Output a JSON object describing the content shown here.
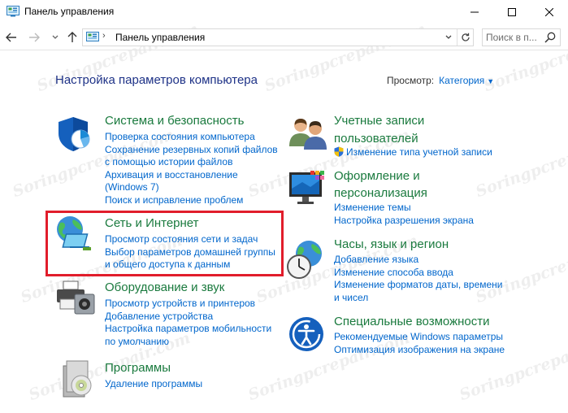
{
  "window": {
    "title": "Панель управления",
    "minimize_icon": "minimize-icon",
    "maximize_icon": "maximize-icon",
    "close_icon": "close-icon"
  },
  "nav": {
    "back_icon": "back-arrow-icon",
    "forward_icon": "forward-arrow-icon",
    "recent_icon": "chevron-down-icon",
    "up_icon": "up-arrow-icon"
  },
  "address": {
    "separator": "›",
    "path": "Панель управления"
  },
  "search": {
    "placeholder": "Поиск в п..."
  },
  "header": {
    "heading": "Настройка параметров компьютера",
    "view_label": "Просмотр:",
    "view_value": "Категория"
  },
  "categories_left": [
    {
      "title": "Система и безопасность",
      "icon": "shield-chart-icon",
      "links": [
        "Проверка состояния компьютера",
        "Сохранение резервных копий файлов",
        "с помощью истории файлов",
        "Архивация и восстановление",
        "(Windows 7)",
        "Поиск и исправление проблем"
      ]
    },
    {
      "title": "Сеть и Интернет",
      "icon": "network-globe-icon",
      "links": [
        "Просмотр состояния сети и задач",
        "Выбор параметров домашней группы",
        "и общего доступа к данным"
      ]
    },
    {
      "title": "Оборудование и звук",
      "icon": "printer-speaker-icon",
      "links": [
        "Просмотр устройств и принтеров",
        "Добавление устройства",
        "Настройка параметров мобильности",
        "по умолчанию"
      ]
    },
    {
      "title": "Программы",
      "icon": "programs-disc-icon",
      "links": [
        "Удаление программы"
      ]
    }
  ],
  "categories_right": [
    {
      "title_line1": "Учетные записи",
      "title_line2": "пользователей",
      "icon": "users-icon",
      "links": [
        "Изменение типа учетной записи"
      ]
    },
    {
      "title_line1": "Оформление и",
      "title_line2": "персонализация",
      "icon": "monitor-palette-icon",
      "links": [
        "Изменение темы",
        "Настройка разрешения экрана"
      ]
    },
    {
      "title": "Часы, язык и регион",
      "icon": "clock-globe-icon",
      "links": [
        "Добавление языка",
        "Изменение способа ввода",
        "Изменение форматов даты, времени",
        "и чисел"
      ]
    },
    {
      "title": "Специальные возможности",
      "icon": "accessibility-icon",
      "links": [
        "Рекомендуемые Windows параметры",
        "Оптимизация изображения на экране"
      ]
    }
  ],
  "watermark": "Soringpcrepair.com",
  "colors": {
    "heading": "#1e3287",
    "category_title": "#1a7a3e",
    "link": "#0066cc",
    "highlight_border": "#e11d2b"
  }
}
